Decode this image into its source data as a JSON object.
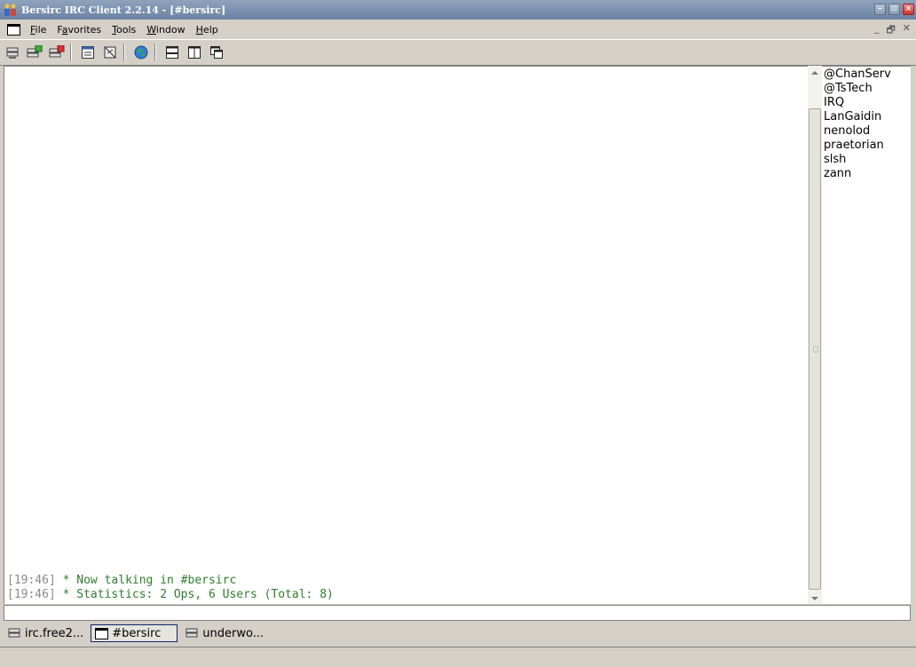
{
  "window": {
    "title": "Bersirc IRC Client 2.2.14 - [#bersirc]"
  },
  "menu": {
    "items": [
      {
        "label": "File"
      },
      {
        "label": "Favorites"
      },
      {
        "label": "Tools"
      },
      {
        "label": "Window"
      },
      {
        "label": "Help"
      }
    ]
  },
  "toolbar": {
    "icons": [
      "server-icon",
      "connect-icon",
      "disconnect-icon",
      "channel-list-icon",
      "options-icon",
      "globe-icon",
      "tile-horizontal-icon",
      "tile-vertical-icon",
      "cascade-icon"
    ]
  },
  "chat": {
    "lines": [
      {
        "time": "[19:46]",
        "text": " * Now talking in #bersirc"
      },
      {
        "time": "[19:46]",
        "text": " * Statistics: 2 Ops, 6 Users (Total: 8)"
      }
    ]
  },
  "nicklist": {
    "nicks": [
      "@ChanServ",
      "@TsTech",
      "IRQ",
      "LanGaidin",
      "nenolod",
      "praetorian",
      "slsh",
      "zann"
    ]
  },
  "input": {
    "value": ""
  },
  "tabs": [
    {
      "label": "irc.free2...",
      "icon": "server-icon",
      "active": false
    },
    {
      "label": "#bersirc",
      "icon": "channel-window-icon",
      "active": true
    },
    {
      "label": "underwo...",
      "icon": "server-icon",
      "active": false
    }
  ],
  "colors": {
    "titlebar": "#7a8fae",
    "timestamp": "#8a8a8a",
    "message": "#2e7d2e"
  }
}
